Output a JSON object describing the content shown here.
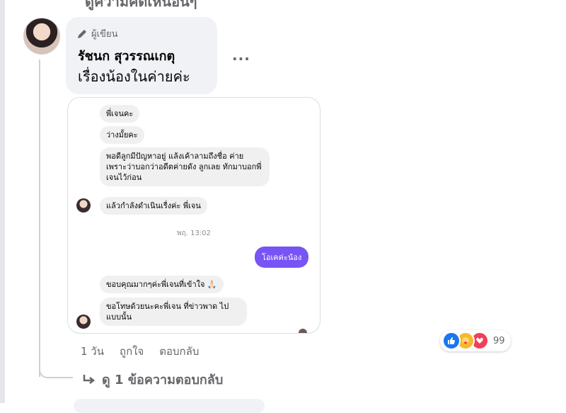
{
  "previous_line": "ดูความคิดเห็นอื่นๆ",
  "comment": {
    "badge_label": "ผู้เขียน",
    "author_name": "รัชนก สุวรรณเกตุ",
    "text": "เรื่องน้องในค่ายค่ะ",
    "more_label": "..."
  },
  "chat_image": {
    "messages_in": [
      "พี่เจนคะ",
      "ว่างมั้ยคะ",
      "พอดีลูกมีปัญหาอยู่ แล้งเค้าลามถึงชื่อ ค่าย เพราะว่าบอกว่าอดีตค่ายดัง ลูกเลย ทักมาบอกพี่เจนไว้ก่อน",
      "แล้วกำลังดำเนินเรื่งค่ะ พี่เจน"
    ],
    "timestamp": "พฤ. 13:02",
    "message_out": "โอเคค่ะน้อง",
    "messages_in_2": [
      "ขอบคุณมากๆค่ะพี่เจนที่เข้าใจ 🙏🏻",
      "ขอโทษด้วยนะคะพี่เจน ที่ข่าวพาด ไปแบบนั้น"
    ]
  },
  "actions": {
    "time": "1 วัน",
    "like": "ถูกใจ",
    "reply": "ตอบกลับ"
  },
  "reactions": {
    "icons": [
      "like-icon",
      "care-icon",
      "love-icon"
    ],
    "count": "99"
  },
  "view_replies": "ดู 1 ข้อความตอบกลับ",
  "colors": {
    "bubble_bg": "#f0f2f5",
    "secondary_text": "#65676b",
    "outgoing_message": "#7754f5",
    "like_blue": "#1877f2",
    "love_red": "#f33e58",
    "care_yellow": "#f7b928"
  }
}
